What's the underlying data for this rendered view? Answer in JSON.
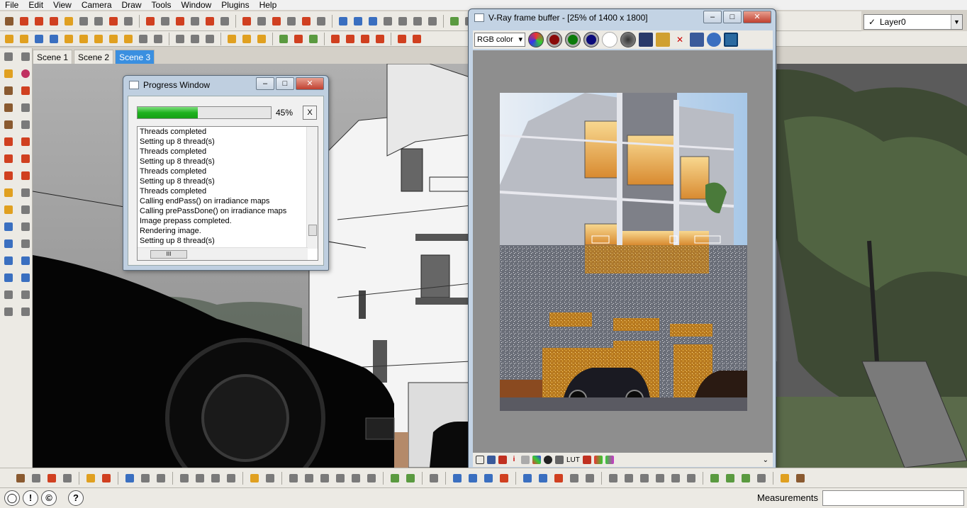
{
  "menu": [
    "File",
    "Edit",
    "View",
    "Camera",
    "Draw",
    "Tools",
    "Window",
    "Plugins",
    "Help"
  ],
  "layer": {
    "check": "✓",
    "name": "Layer0"
  },
  "scenes": [
    {
      "label": "Scene 1"
    },
    {
      "label": "Scene 2"
    },
    {
      "label": "Scene 3"
    }
  ],
  "progress_window": {
    "title": "Progress Window",
    "percent_text": "45%",
    "progress": 0.45,
    "close_label": "X",
    "log": [
      "Threads completed",
      "Setting up 8 thread(s)",
      "Threads completed",
      "Setting up 8 thread(s)",
      "Threads completed",
      "Setting up 8 thread(s)",
      "Threads completed",
      "Calling endPass() on irradiance maps",
      "Calling prePassDone() on irradiance maps",
      "Image prepass completed.",
      "Rendering image.",
      "Setting up 8 thread(s)"
    ],
    "hscroll_grip": "III"
  },
  "vfb": {
    "title": "V-Ray frame buffer - [25% of 1400 x 1800]",
    "channel": "RGB color",
    "lut_label": "LUT"
  },
  "status": {
    "measurements_label": "Measurements",
    "info_icon": "!",
    "help_icon": "?"
  },
  "colors": {
    "accent_tab": "#3a8fe0",
    "progress_fill": "#1fb11f"
  }
}
